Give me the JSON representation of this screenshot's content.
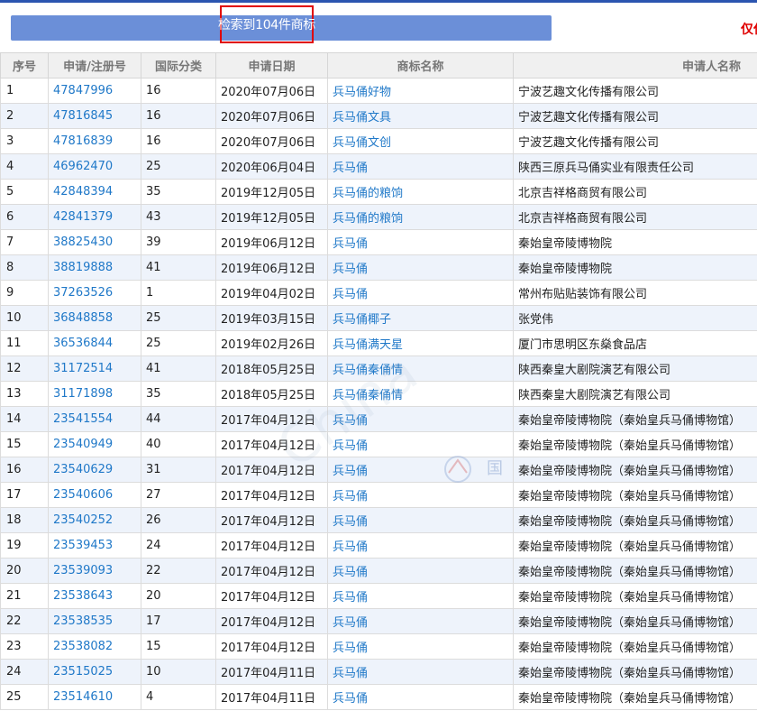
{
  "banner": {
    "text": "检索到104件商标"
  },
  "notice": {
    "text": "仅仅"
  },
  "watermark": {
    "text": "China",
    "brand": "国"
  },
  "table": {
    "headers": [
      "序号",
      "申请/注册号",
      "国际分类",
      "申请日期",
      "商标名称",
      "申请人名称"
    ],
    "rows": [
      [
        "1",
        "47847996",
        "16",
        "2020年07月06日",
        "兵马俑好物",
        "宁波艺趣文化传播有限公司"
      ],
      [
        "2",
        "47816845",
        "16",
        "2020年07月06日",
        "兵马俑文具",
        "宁波艺趣文化传播有限公司"
      ],
      [
        "3",
        "47816839",
        "16",
        "2020年07月06日",
        "兵马俑文创",
        "宁波艺趣文化传播有限公司"
      ],
      [
        "4",
        "46962470",
        "25",
        "2020年06月04日",
        "兵马俑",
        "陕西三原兵马俑实业有限责任公司"
      ],
      [
        "5",
        "42848394",
        "35",
        "2019年12月05日",
        "兵马俑的粮饷",
        "北京吉祥格商贸有限公司"
      ],
      [
        "6",
        "42841379",
        "43",
        "2019年12月05日",
        "兵马俑的粮饷",
        "北京吉祥格商贸有限公司"
      ],
      [
        "7",
        "38825430",
        "39",
        "2019年06月12日",
        "兵马俑",
        "秦始皇帝陵博物院"
      ],
      [
        "8",
        "38819888",
        "41",
        "2019年06月12日",
        "兵马俑",
        "秦始皇帝陵博物院"
      ],
      [
        "9",
        "37263526",
        "1",
        "2019年04月02日",
        "兵马俑",
        "常州布贴贴装饰有限公司"
      ],
      [
        "10",
        "36848858",
        "25",
        "2019年03月15日",
        "兵马俑椰子",
        "张党伟"
      ],
      [
        "11",
        "36536844",
        "25",
        "2019年02月26日",
        "兵马俑满天星",
        "厦门市思明区东燊食品店"
      ],
      [
        "12",
        "31172514",
        "41",
        "2018年05月25日",
        "兵马俑秦俑情",
        "陕西秦皇大剧院演艺有限公司"
      ],
      [
        "13",
        "31171898",
        "35",
        "2018年05月25日",
        "兵马俑秦俑情",
        "陕西秦皇大剧院演艺有限公司"
      ],
      [
        "14",
        "23541554",
        "44",
        "2017年04月12日",
        "兵马俑",
        "秦始皇帝陵博物院（秦始皇兵马俑博物馆）"
      ],
      [
        "15",
        "23540949",
        "40",
        "2017年04月12日",
        "兵马俑",
        "秦始皇帝陵博物院（秦始皇兵马俑博物馆）"
      ],
      [
        "16",
        "23540629",
        "31",
        "2017年04月12日",
        "兵马俑",
        "秦始皇帝陵博物院（秦始皇兵马俑博物馆）"
      ],
      [
        "17",
        "23540606",
        "27",
        "2017年04月12日",
        "兵马俑",
        "秦始皇帝陵博物院（秦始皇兵马俑博物馆）"
      ],
      [
        "18",
        "23540252",
        "26",
        "2017年04月12日",
        "兵马俑",
        "秦始皇帝陵博物院（秦始皇兵马俑博物馆）"
      ],
      [
        "19",
        "23539453",
        "24",
        "2017年04月12日",
        "兵马俑",
        "秦始皇帝陵博物院（秦始皇兵马俑博物馆）"
      ],
      [
        "20",
        "23539093",
        "22",
        "2017年04月12日",
        "兵马俑",
        "秦始皇帝陵博物院（秦始皇兵马俑博物馆）"
      ],
      [
        "21",
        "23538643",
        "20",
        "2017年04月12日",
        "兵马俑",
        "秦始皇帝陵博物院（秦始皇兵马俑博物馆）"
      ],
      [
        "22",
        "23538535",
        "17",
        "2017年04月12日",
        "兵马俑",
        "秦始皇帝陵博物院（秦始皇兵马俑博物馆）"
      ],
      [
        "23",
        "23538082",
        "15",
        "2017年04月12日",
        "兵马俑",
        "秦始皇帝陵博物院（秦始皇兵马俑博物馆）"
      ],
      [
        "24",
        "23515025",
        "10",
        "2017年04月11日",
        "兵马俑",
        "秦始皇帝陵博物院（秦始皇兵马俑博物馆）"
      ],
      [
        "25",
        "23514610",
        "4",
        "2017年04月11日",
        "兵马俑",
        "秦始皇帝陵博物院（秦始皇兵马俑博物馆）"
      ]
    ]
  }
}
